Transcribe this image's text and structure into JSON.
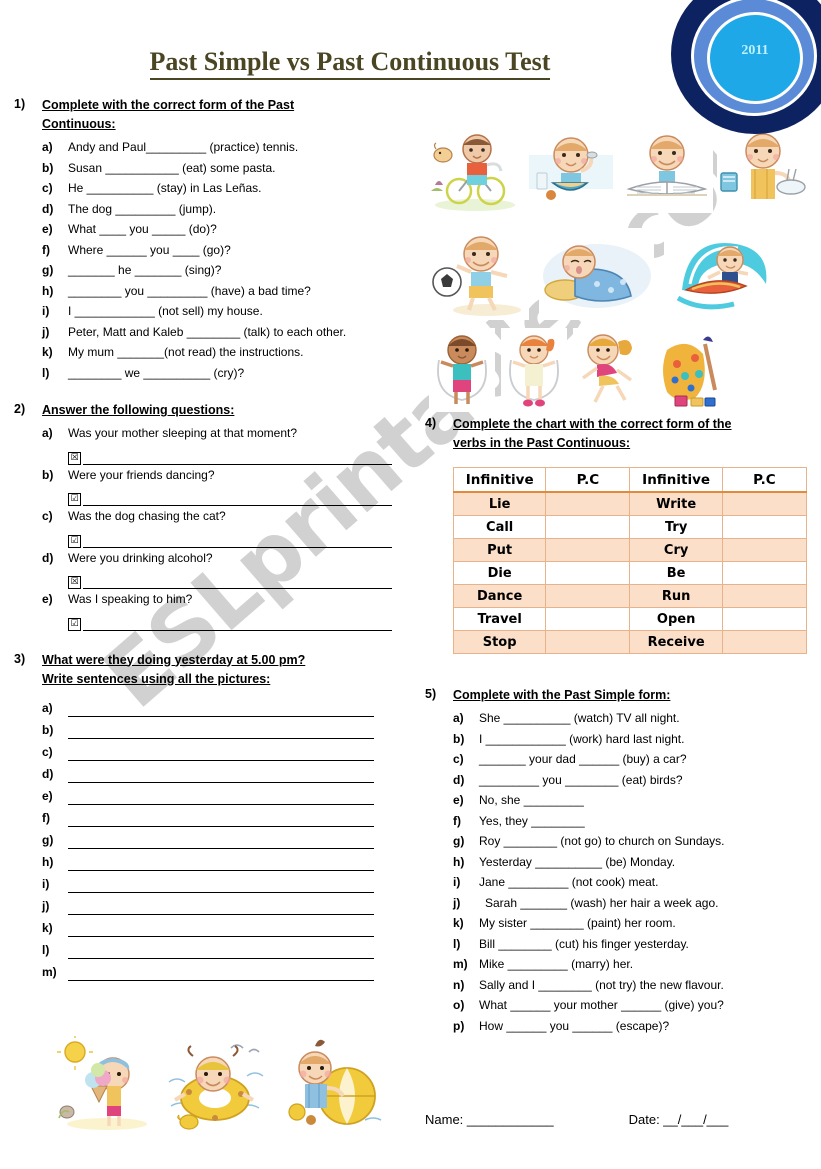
{
  "title": "Past Simple vs Past Continuous Test",
  "logo": {
    "year": "2011"
  },
  "watermark": "ESLprintables.com",
  "ex1": {
    "number": "1)",
    "heading_line1": "Complete with the correct form of the Past",
    "heading_line2": "Continuous:",
    "items": [
      {
        "letter": "a)",
        "text": "Andy and Paul_________ (practice) tennis."
      },
      {
        "letter": "b)",
        "text": "Susan ___________ (eat) some pasta."
      },
      {
        "letter": "c)",
        "text": "He __________ (stay) in Las Leñas."
      },
      {
        "letter": "d)",
        "text": "The dog _________ (jump)."
      },
      {
        "letter": "e)",
        "text": "What ____ you _____ (do)?"
      },
      {
        "letter": "f)",
        "text": "Where ______ you ____ (go)?"
      },
      {
        "letter": "g)",
        "text": "_______ he _______ (sing)?"
      },
      {
        "letter": "h)",
        "text": "________ you _________ (have) a bad time?"
      },
      {
        "letter": "i)",
        "text": "I ____________ (not sell) my house."
      },
      {
        "letter": "j)",
        "text": "Peter, Matt and Kaleb ________ (talk) to each other."
      },
      {
        "letter": "k)",
        "text": "My mum _______(not read) the instructions."
      },
      {
        "letter": "l)",
        "text": "________ we __________ (cry)?"
      }
    ]
  },
  "ex2": {
    "number": "2)",
    "heading": "Answer the following questions:",
    "items": [
      {
        "letter": "a)",
        "question": "Was your mother sleeping at that moment?",
        "check": "☒"
      },
      {
        "letter": "b)",
        "question": "Were your friends dancing?",
        "check": "☑"
      },
      {
        "letter": "c)",
        "question": "Was the dog chasing the cat?",
        "check": "☑"
      },
      {
        "letter": "d)",
        "question": "Were you drinking alcohol?",
        "check": "☒"
      },
      {
        "letter": "e)",
        "question": "Was I speaking to him?",
        "check": "☑"
      }
    ]
  },
  "ex3": {
    "number": "3)",
    "heading_line1": "What were they doing yesterday at 5.00 pm?",
    "heading_line2": "Write sentences using all the pictures:",
    "letters": [
      "a)",
      "b)",
      "c)",
      "d)",
      "e)",
      "f)",
      "g)",
      "h)",
      "i)",
      "j)",
      "k)",
      "l)",
      "m)"
    ]
  },
  "ex4": {
    "number": "4)",
    "heading_line1": "Complete the chart with the correct form of the",
    "heading_line2": "verbs in the Past Continuous:",
    "headers": [
      "Infinitive",
      "P.C",
      "Infinitive",
      "P.C"
    ],
    "rows": [
      {
        "left": "Lie",
        "right": "Write",
        "shade": true
      },
      {
        "left": "Call",
        "right": "Try",
        "shade": false
      },
      {
        "left": "Put",
        "right": "Cry",
        "shade": true
      },
      {
        "left": "Die",
        "right": "Be",
        "shade": false
      },
      {
        "left": "Dance",
        "right": "Run",
        "shade": true
      },
      {
        "left": "Travel",
        "right": "Open",
        "shade": false
      },
      {
        "left": "Stop",
        "right": "Receive",
        "shade": true
      }
    ]
  },
  "ex5": {
    "number": "5)",
    "heading": "Complete with the Past Simple form:",
    "items": [
      {
        "letter": "a)",
        "text": "She __________ (watch) TV all night."
      },
      {
        "letter": "b)",
        "text": "I ____________ (work) hard last night."
      },
      {
        "letter": "c)",
        "text": "_______ your dad ______ (buy) a car?"
      },
      {
        "letter": "d)",
        "text": "_________ you ________ (eat) birds?"
      },
      {
        "letter": "e)",
        "text": "No, she _________"
      },
      {
        "letter": "f)",
        "text": "Yes, they ________"
      },
      {
        "letter": "g)",
        "text": "Roy ________ (not go) to church on Sundays."
      },
      {
        "letter": "h)",
        "text": "Yesterday __________ (be) Monday."
      },
      {
        "letter": "i)",
        "text": "Jane _________ (not cook) meat."
      },
      {
        "letter": "j)",
        "text": "Sarah _______ (wash) her hair a week ago."
      },
      {
        "letter": "k)",
        "text": "My sister ________ (paint) her room."
      },
      {
        "letter": "l)",
        "text": "Bill ________ (cut) his finger yesterday."
      },
      {
        "letter": "m)",
        "text": "Mike _________ (marry) her."
      },
      {
        "letter": "n)",
        "text": "Sally and I ________ (not try) the new flavour."
      },
      {
        "letter": "o)",
        "text": "What ______ your mother ______ (give) you?"
      },
      {
        "letter": "p)",
        "text": "How ______ you ______ (escape)?"
      }
    ]
  },
  "footer": {
    "name_label": "Name: ____________",
    "date_label": "Date: __/___/___"
  },
  "pictures": {
    "row1": [
      "child-riding-bicycle",
      "child-eating-soup",
      "child-reading-book",
      "child-washing-dishes"
    ],
    "row2": [
      "child-playing-football",
      "child-sleeping",
      "child-surfing"
    ],
    "row3": [
      "boy-jumping-rope",
      "girl-jumping-rope",
      "girl-dancing",
      "child-painting"
    ],
    "row_bottom": [
      "child-eating-ice-cream",
      "child-swimming-ring",
      "child-beach-ball"
    ]
  }
}
